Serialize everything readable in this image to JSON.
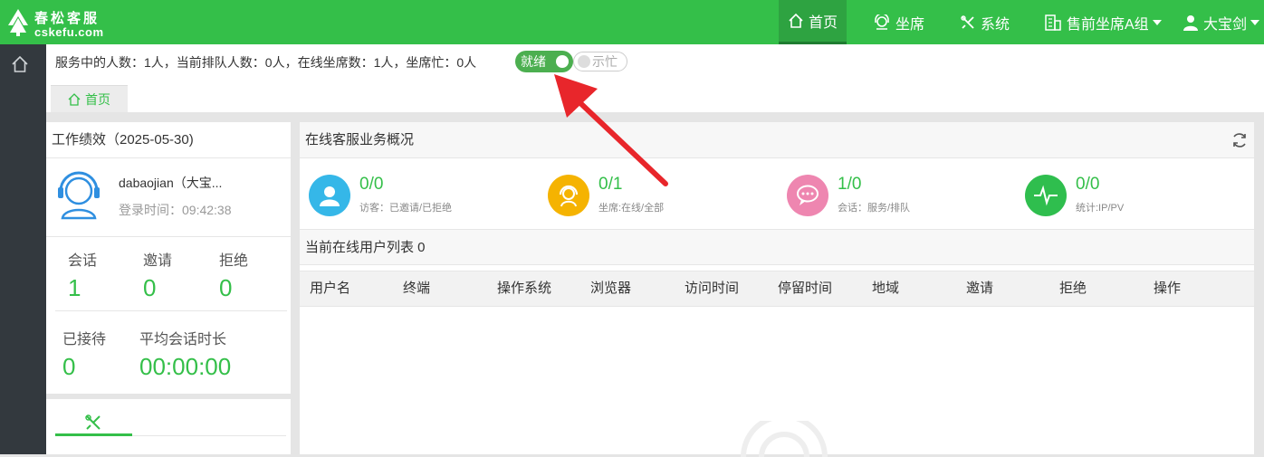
{
  "brand": {
    "name_cn": "春松客服",
    "name_en": "cskefu.com"
  },
  "nav": [
    {
      "label": "首页",
      "icon": "home-icon",
      "active": true
    },
    {
      "label": "坐席",
      "icon": "headset-icon",
      "active": false
    },
    {
      "label": "系统",
      "icon": "tools-icon",
      "active": false
    },
    {
      "label": "售前坐席A组",
      "icon": "building-icon",
      "active": false
    },
    {
      "label": "大宝剑",
      "icon": "user-icon",
      "active": false
    }
  ],
  "status": {
    "summary": "服务中的人数：1人，当前排队人数：0人，在线坐席数：1人，坐席忙：0人",
    "ready_label": "就绪",
    "busy_label": "示忙"
  },
  "tab": {
    "label": "首页"
  },
  "performance": {
    "title": "工作绩效（2025-05-30)",
    "user_name": "dabaojian（大宝...",
    "login_time": "登录时间：09:42:38",
    "metrics": [
      {
        "label": "会话",
        "value": "1"
      },
      {
        "label": "邀请",
        "value": "0"
      },
      {
        "label": "拒绝",
        "value": "0"
      },
      {
        "label": "已接待",
        "value": "0"
      },
      {
        "label": "平均会话时长",
        "value": "00:00:00"
      }
    ]
  },
  "business": {
    "title": "在线客服业务概况",
    "stats": [
      {
        "value": "0/0",
        "label": "访客：已邀请/已拒绝",
        "color": "#35b7e8"
      },
      {
        "value": "0/1",
        "label": "坐席:在线/全部",
        "color": "#f5b301"
      },
      {
        "value": "1/0",
        "label": "会话：服务/排队",
        "color": "#ee86b0"
      },
      {
        "value": "0/0",
        "label": "统计:IP/PV",
        "color": "#2fbe4e"
      }
    ]
  },
  "user_list": {
    "title": "当前在线用户列表 0",
    "columns": [
      "用户名",
      "终端",
      "操作系统",
      "浏览器",
      "访问时间",
      "停留时间",
      "地域",
      "邀请",
      "拒绝",
      "操作"
    ]
  },
  "colors": {
    "primary": "#34bf49",
    "sidebar": "#33393e",
    "annotation_arrow": "#e8262b"
  }
}
